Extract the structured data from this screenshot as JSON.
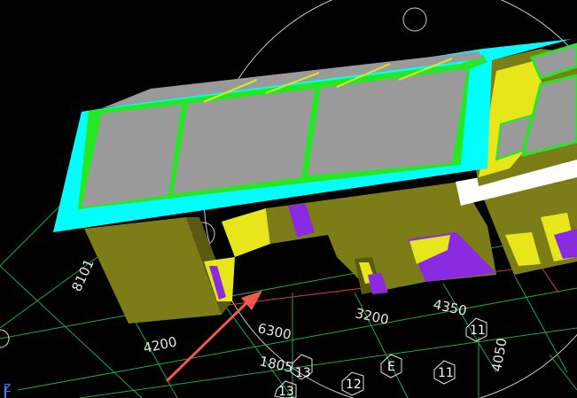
{
  "viewport": {
    "background": "#000000",
    "colors": {
      "grid": "#1fa64a",
      "grid_red": "#e23b3b",
      "wall": "#7d7d18",
      "wall_dark": "#5a5a10",
      "roof": "#9a9a9a",
      "roof_frame": "#25e825",
      "fascia": "#00ffff",
      "yellow": "#e6e61a",
      "purple": "#8a2be2",
      "arrow": "#f05a4a"
    }
  },
  "dimensions": {
    "d_8101": "8101",
    "d_4200": "4200",
    "d_6300": "6300",
    "d_3200": "3200",
    "d_4350": "4350",
    "d_1805": "1805",
    "d_4050": "4050"
  },
  "axis_bubbles": {
    "b_13a": "13",
    "b_13b": "13",
    "b_12": "12",
    "b_e": "E",
    "b_11a": "11",
    "b_11b": "11"
  },
  "ucs_icon": "z-axis-icon"
}
